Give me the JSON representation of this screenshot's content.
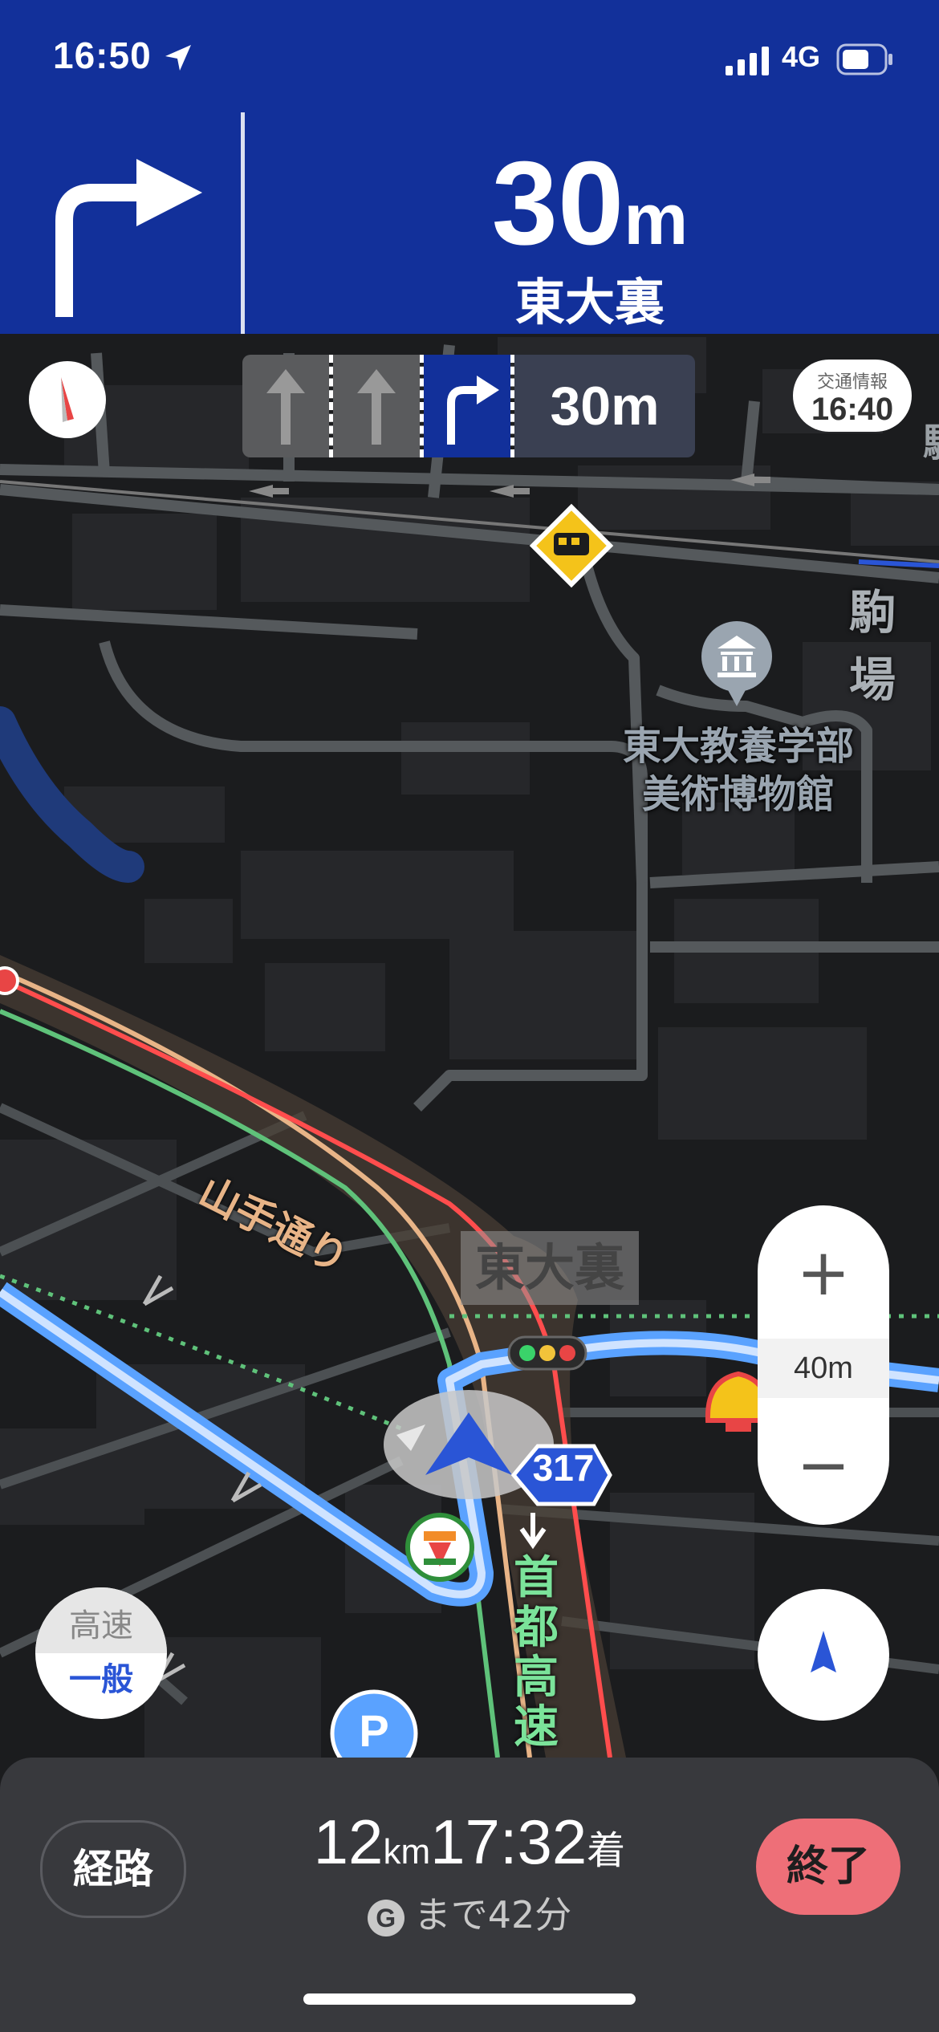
{
  "status_bar": {
    "time": "16:50",
    "network": "4G"
  },
  "guidance": {
    "distance_value": "30",
    "distance_unit": "m",
    "street": "東大裏",
    "turn": "right"
  },
  "lane_guide": {
    "distance": "30m",
    "lanes": [
      "straight",
      "straight",
      "right"
    ]
  },
  "traffic_info": {
    "label": "交通情報",
    "time": "16:40"
  },
  "map_labels": {
    "poi_line1": "東大教養学部",
    "poi_line2": "美術博物館",
    "area": "駒場",
    "area_cut": "駒",
    "street_tag": "東大裏",
    "road_yamate": "山手通り",
    "route_number": "317",
    "highway": [
      "首",
      "都",
      "高",
      "速"
    ],
    "parking": "P"
  },
  "zoom": {
    "plus": "+",
    "scale": "40m",
    "minus": "−"
  },
  "road_toggle": {
    "highway": "高速",
    "general": "一般"
  },
  "bottom_panel": {
    "route_button": "経路",
    "distance_value": "12",
    "distance_unit": "km",
    "arrival_time": "17:32",
    "arrival_suffix": "着",
    "remaining_icon": "G",
    "remaining": "まで42分",
    "end_button": "終了"
  },
  "colors": {
    "banner": "#12309a",
    "route": "#5aa2ff",
    "end_button": "#ee6f78",
    "highway_green": "#7be39a",
    "road_orange": "#e8b487"
  }
}
